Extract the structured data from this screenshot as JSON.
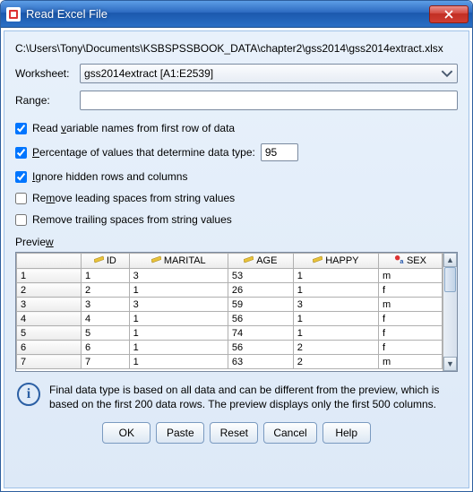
{
  "window": {
    "title": "Read Excel File"
  },
  "path": "C:\\Users\\Tony\\Documents\\KSBSPSSBOOK_DATA\\chapter2\\gss2014\\gss2014extract.xlsx",
  "fields": {
    "worksheet_label": "Worksheet:",
    "worksheet_value": "gss2014extract [A1:E2539]",
    "range_label": "Range:",
    "range_value": ""
  },
  "checks": {
    "read_var": {
      "label_pre": "Read ",
      "label_u": "v",
      "label_post": "ariable names from first row of data",
      "checked": true
    },
    "pct": {
      "label_pre": "",
      "label_u": "P",
      "label_post": "ercentage of values that determine data type:",
      "checked": true,
      "value": "95"
    },
    "ignore_hidden": {
      "label_pre": "",
      "label_u": "I",
      "label_post": "gnore hidden rows and columns",
      "checked": true
    },
    "remove_leading": {
      "label_pre": "Re",
      "label_u": "m",
      "label_post": "ove leading spaces from string values",
      "checked": false
    },
    "remove_trailing": {
      "label_pre": "Remove trailin",
      "label_u": "g",
      "label_post": " spaces from string values",
      "checked": false
    }
  },
  "preview": {
    "label_pre": "Previe",
    "label_u": "w",
    "columns": [
      "ID",
      "MARITAL",
      "AGE",
      "HAPPY",
      "SEX"
    ],
    "col_types": [
      "ruler",
      "ruler",
      "ruler",
      "ruler",
      "char"
    ],
    "rows": [
      {
        "n": "1",
        "cells": [
          "1",
          "3",
          "53",
          "1",
          "m"
        ]
      },
      {
        "n": "2",
        "cells": [
          "2",
          "1",
          "26",
          "1",
          "f"
        ]
      },
      {
        "n": "3",
        "cells": [
          "3",
          "3",
          "59",
          "3",
          "m"
        ]
      },
      {
        "n": "4",
        "cells": [
          "4",
          "1",
          "56",
          "1",
          "f"
        ]
      },
      {
        "n": "5",
        "cells": [
          "5",
          "1",
          "74",
          "1",
          "f"
        ]
      },
      {
        "n": "6",
        "cells": [
          "6",
          "1",
          "56",
          "2",
          "f"
        ]
      },
      {
        "n": "7",
        "cells": [
          "7",
          "1",
          "63",
          "2",
          "m"
        ]
      }
    ]
  },
  "info_text": "Final data type is based on all data and can be different from the preview, which is based on the first 200 data rows. The preview displays only the first 500 columns.",
  "buttons": {
    "ok": "OK",
    "paste": "Paste",
    "reset": "Reset",
    "cancel": "Cancel",
    "help": "Help"
  }
}
